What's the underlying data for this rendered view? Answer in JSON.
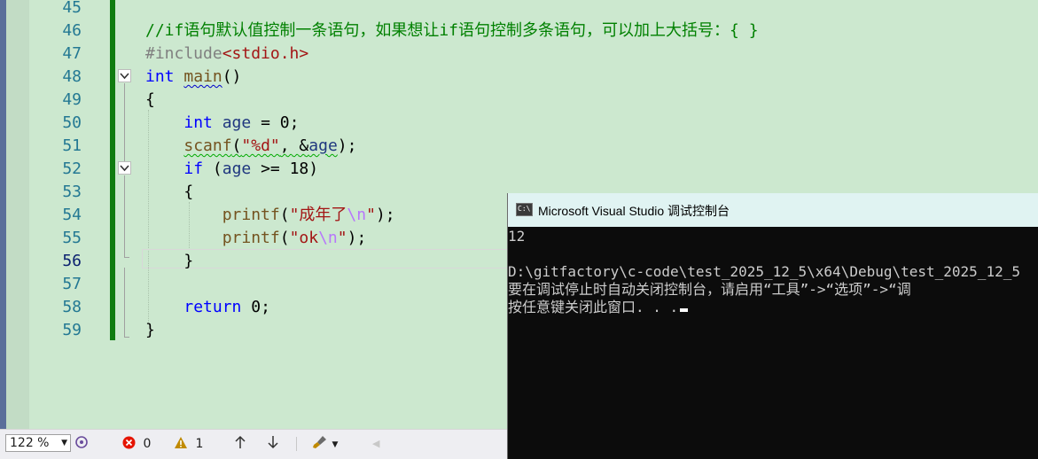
{
  "editor": {
    "line_numbers": [
      "45",
      "46",
      "47",
      "48",
      "49",
      "50",
      "51",
      "52",
      "53",
      "54",
      "55",
      "56",
      "57",
      "58",
      "59"
    ],
    "current_line": "56",
    "lines": [
      [],
      [
        {
          "t": "//if语句默认值控制一条语句，如果想让if语句控制多条语句，可以加上大括号：{ }",
          "c": "cm"
        }
      ],
      [
        {
          "t": "#include",
          "c": "pp"
        },
        {
          "t": "<stdio.h>",
          "c": "str"
        }
      ],
      [
        {
          "t": "int",
          "c": "kw"
        },
        {
          "t": " "
        },
        {
          "t": "main",
          "c": "fn sq"
        },
        {
          "t": "()"
        }
      ],
      [
        {
          "t": "{"
        }
      ],
      [
        {
          "t": "    "
        },
        {
          "t": "int",
          "c": "kw"
        },
        {
          "t": " "
        },
        {
          "t": "age",
          "c": "var"
        },
        {
          "t": " = 0;"
        }
      ],
      [
        {
          "t": "    "
        },
        {
          "t": "scanf",
          "c": "fn sqg"
        },
        {
          "t": "(",
          "c": "sqg"
        },
        {
          "t": "\"%d\"",
          "c": "str sqg"
        },
        {
          "t": ", &",
          "c": "sqg"
        },
        {
          "t": "age",
          "c": "var sqg"
        },
        {
          "t": ");"
        }
      ],
      [
        {
          "t": "    "
        },
        {
          "t": "if",
          "c": "kw"
        },
        {
          "t": " ("
        },
        {
          "t": "age",
          "c": "var"
        },
        {
          "t": " >= 18)"
        }
      ],
      [
        {
          "t": "    {"
        }
      ],
      [
        {
          "t": "        "
        },
        {
          "t": "printf",
          "c": "fn"
        },
        {
          "t": "("
        },
        {
          "t": "\"成年了",
          "c": "str"
        },
        {
          "t": "\\n",
          "c": "esc"
        },
        {
          "t": "\"",
          "c": "str"
        },
        {
          "t": ");"
        }
      ],
      [
        {
          "t": "        "
        },
        {
          "t": "printf",
          "c": "fn"
        },
        {
          "t": "("
        },
        {
          "t": "\"ok",
          "c": "str"
        },
        {
          "t": "\\n",
          "c": "esc"
        },
        {
          "t": "\"",
          "c": "str"
        },
        {
          "t": ");"
        }
      ],
      [
        {
          "t": "    }"
        }
      ],
      [],
      [
        {
          "t": "    "
        },
        {
          "t": "return",
          "c": "kw"
        },
        {
          "t": " 0;"
        }
      ],
      [
        {
          "t": "}"
        }
      ]
    ]
  },
  "statusbar": {
    "zoom": "122 %",
    "errors": "0",
    "warnings": "1",
    "up_icon": "arrow-up-icon",
    "down_icon": "arrow-down-icon",
    "cleanup_icon": "brush-icon"
  },
  "console": {
    "title": "Microsoft Visual Studio 调试控制台",
    "icon_text": "C:\\",
    "lines": [
      "12",
      "",
      "D:\\gitfactory\\c-code\\test_2025_12_5\\x64\\Debug\\test_2025_12_5",
      "要在调试停止时自动关闭控制台，请启用“工具”->“选项”->“调",
      "按任意键关闭此窗口. . ."
    ]
  },
  "colors": {
    "editor_bg": "#cce8cf",
    "keyword": "#0000ff",
    "comment": "#008000",
    "string": "#a31515",
    "function": "#74531f",
    "variable": "#1f377f",
    "line_number": "#237893",
    "change_bar": "#107c10",
    "console_bg": "#0c0c0c",
    "console_title_bg": "#e0f3f2"
  }
}
